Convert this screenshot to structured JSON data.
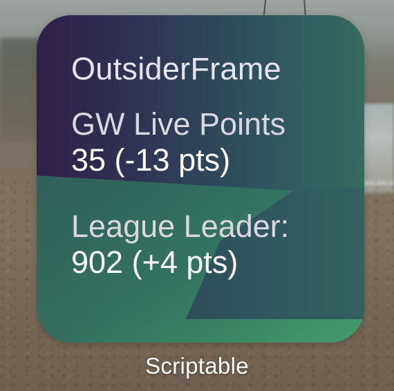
{
  "widget": {
    "title": "OutsiderFrame",
    "stats": [
      {
        "label": "GW Live Points",
        "value": "35 (-13 pts)"
      },
      {
        "label": "League Leader:",
        "value": "902 (+4 pts)"
      }
    ]
  },
  "app": {
    "label": "Scriptable"
  },
  "colors": {
    "widget_gradient_start": "#2f1f48",
    "widget_gradient_end": "#356b5f",
    "accent_green": "#46a06c",
    "text_primary": "#ffffff",
    "text_secondary": "#d8d8de"
  }
}
